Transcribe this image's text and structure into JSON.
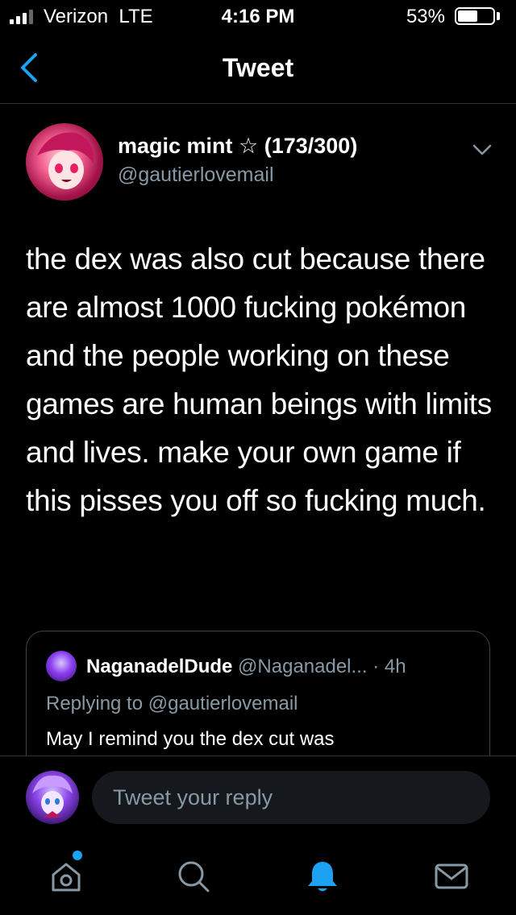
{
  "status_bar": {
    "carrier": "Verizon",
    "network": "LTE",
    "time": "4:16 PM",
    "battery": "53%"
  },
  "nav": {
    "title": "Tweet"
  },
  "tweet": {
    "author_name": "magic mint ☆ (173/300)",
    "author_handle": "@gautierlovemail",
    "text": "the dex was also cut because there are almost 1000 fucking pokémon and the people working on these games are human beings with limits and lives. make your own game if this pisses you off so fucking much."
  },
  "quoted_tweet": {
    "name": "NaganadelDude",
    "handle": "@Naganadel...",
    "time": "· 4h",
    "replying_to": "Replying to @gautierlovemail",
    "text": "May I remind you the dex cut was"
  },
  "reply": {
    "placeholder": "Tweet your reply"
  },
  "colors": {
    "accent": "#1da1f2",
    "muted": "#8899a6",
    "background": "#000000"
  },
  "tabs": [
    "home-icon",
    "search-icon",
    "notifications-icon",
    "messages-icon"
  ]
}
